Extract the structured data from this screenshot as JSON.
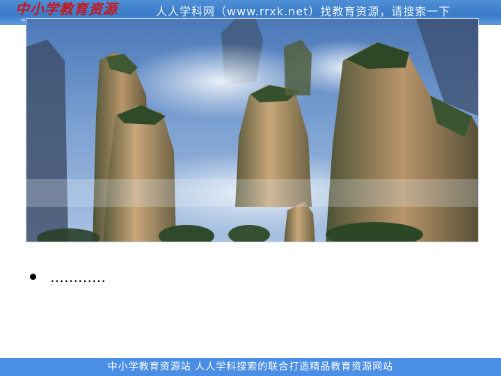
{
  "header": {
    "logo_text": "中小学教育资源",
    "logo_sub": "www",
    "banner_text": "人人学科网（www.rrxk.net）找教育资源，请搜索一下"
  },
  "main": {
    "photo_icon": "mountain-landscape-image",
    "bullets": [
      {
        "text": "…………"
      }
    ]
  },
  "footer": {
    "text": "中小学教育资源站 人人学科搜索的联合打造精品教育资源网站"
  },
  "colors": {
    "banner": "#3a7bc8",
    "footer": "#4a8ee6",
    "logo": "#c8151b"
  }
}
